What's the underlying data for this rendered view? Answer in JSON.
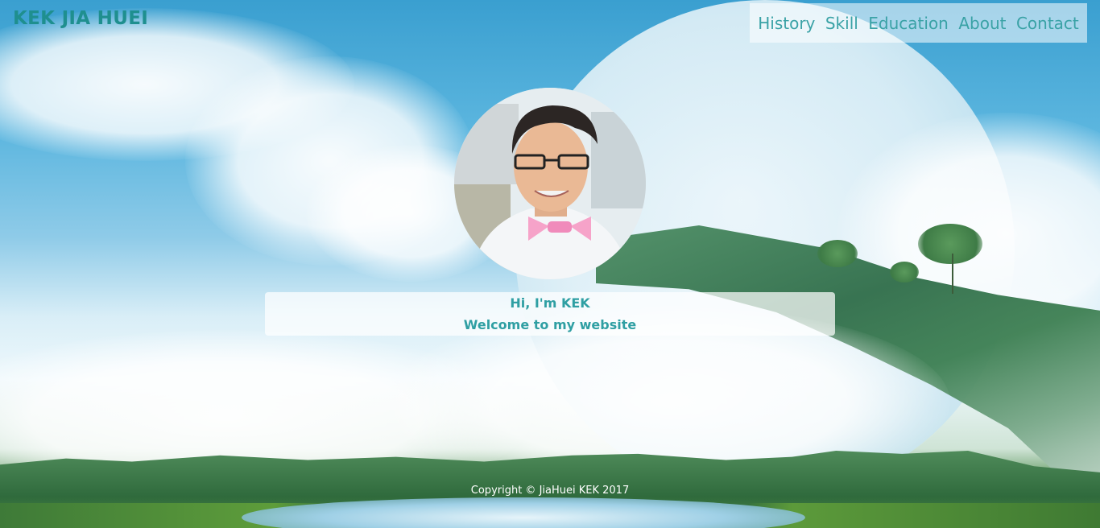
{
  "header": {
    "brand": "KEK JIA HUEI"
  },
  "nav": {
    "items": [
      {
        "label": "History"
      },
      {
        "label": "Skill"
      },
      {
        "label": "Education"
      },
      {
        "label": "About"
      },
      {
        "label": "Contact"
      }
    ]
  },
  "hero": {
    "greeting": "Hi, I'm KEK",
    "welcome": "Welcome to my website"
  },
  "footer": {
    "copyright": "Copyright © JiaHuei KEK 2017"
  },
  "colors": {
    "accent": "#2f9fa3",
    "brand": "#1f8f8f"
  }
}
